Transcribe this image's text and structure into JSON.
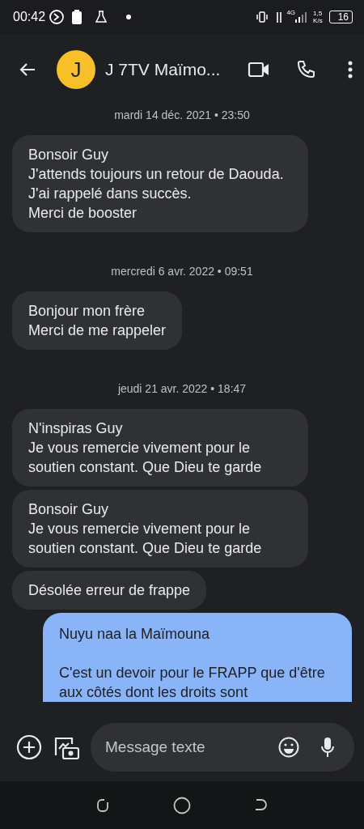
{
  "status_bar": {
    "time": "00:42",
    "network": "4G",
    "speed_value": "1,5",
    "speed_unit": "K/s",
    "battery": "16"
  },
  "header": {
    "avatar_letter": "J",
    "contact": "J 7TV Maïmo..."
  },
  "conversation": [
    {
      "kind": "timestamp",
      "text": "mardi 14 déc. 2021 • 23:50"
    },
    {
      "kind": "received",
      "text": "Bonsoir Guy\nJ'attends toujours un retour de Daouda. J'ai rappelé dans succès.\nMerci de booster"
    },
    {
      "kind": "timestamp",
      "text": "mercredi 6 avr. 2022 • 09:51"
    },
    {
      "kind": "received",
      "text": "Bonjour mon frère\nMerci de me rappeler"
    },
    {
      "kind": "timestamp",
      "text": "jeudi 21 avr. 2022 • 18:47"
    },
    {
      "kind": "received",
      "text": "N'inspiras Guy\nJe vous remercie vivement pour le soutien constant. Que Dieu te garde"
    },
    {
      "kind": "received",
      "text": "Bonsoir Guy\nJe vous remercie vivement pour le soutien constant. Que Dieu te garde"
    },
    {
      "kind": "received",
      "text": "Désolée erreur de frappe"
    },
    {
      "kind": "sent",
      "text": "Nuyu naa la Maïmouna\n\nC'est un devoir pour le FRAPP que d'être aux côtés dont les droits sont"
    }
  ],
  "compose": {
    "placeholder": "Message texte"
  }
}
